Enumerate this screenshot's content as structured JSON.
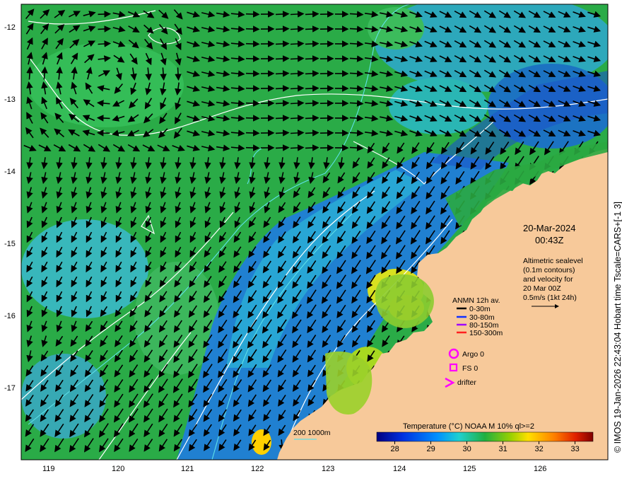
{
  "map": {
    "date": "20-Mar-2024",
    "time": "00:43Z",
    "altimetry_note": [
      "Altimetric sealevel",
      "(0.1m contours)",
      "and velocity for",
      "20 Mar 00Z",
      "0.5m/s (1kt 24h)"
    ],
    "credit": "© IMOS 19-Jan-2026 22:43:04 Hobart time Tscale=CARS+[-1 3]",
    "lon_ticks": [
      "119",
      "120",
      "121",
      "122",
      "123",
      "124",
      "125",
      "126"
    ],
    "lat_ticks": [
      "-12",
      "-13",
      "-14",
      "-15",
      "-16",
      "-17"
    ],
    "colors": {
      "land": "#f7c99a",
      "sea_green": "#22b14c",
      "sea_blue": "#1f7be0",
      "sea_cyan": "#2fc4d8",
      "contour_white": "#ffffff",
      "isobath_cyan": "#5fe0e8",
      "argo_magenta": "#ff00ff"
    }
  },
  "legend": {
    "moorings_title": "ANMN 12h av.",
    "moorings": [
      {
        "label": "0-30m",
        "color": "#000000"
      },
      {
        "label": "30-80m",
        "color": "#1030ff"
      },
      {
        "label": "80-150m",
        "color": "#a000ff"
      },
      {
        "label": "150-300m",
        "color": "#ff2020"
      }
    ],
    "argo": "Argo 0",
    "fs": "FS 0",
    "drifter": "drifter",
    "isobath_label": "200  1000m"
  },
  "colorbar": {
    "title": "Temperature (°C) NOAA  M 10% ql>=2",
    "ticks": [
      "28",
      "29",
      "30",
      "31",
      "32",
      "33"
    ],
    "range": [
      27.5,
      33.5
    ]
  }
}
